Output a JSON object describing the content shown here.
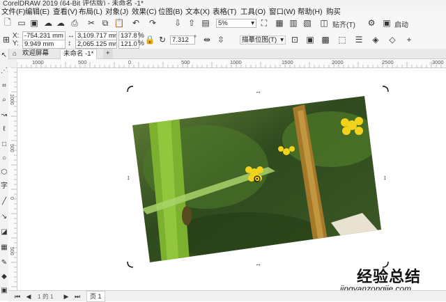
{
  "title": "CorelDRAW 2019 (64-Bit 评估版) - 未命名 -1*",
  "menu": [
    "文件(F)",
    "编辑(E)",
    "查看(V)",
    "布局(L)",
    "对象(J)",
    "效果(C)",
    "位图(B)",
    "文本(X)",
    "表格(T)",
    "工具(O)",
    "窗口(W)",
    "帮助(H)",
    "购买"
  ],
  "toolbar": {
    "zoom_value": "5%",
    "paste_label": "贴齐(T)",
    "launch_label": "启动"
  },
  "props": {
    "x_label": "X:",
    "x_value": "-754.231 mm",
    "y_label": "Y:",
    "y_value": "9.949 mm",
    "w_value": "3,109.717 mm",
    "h_value": "2,065.125 mm",
    "scale_w": "137.8",
    "scale_h": "121.0",
    "pct": "%",
    "angle_value": "7.312",
    "angle_unit": "°",
    "trace_label": "描摹位图(T)"
  },
  "tabs": {
    "welcome": "欢迎屏幕",
    "doc": "未命名 -1*",
    "add": "+"
  },
  "ruler": {
    "h_ticks": [
      "1000",
      "500",
      "0",
      "500",
      "1000",
      "1500",
      "2000",
      "2500",
      "3000"
    ],
    "v_ticks": [
      "1000",
      "500",
      "0",
      "500"
    ]
  },
  "status": {
    "page_label": "页 1",
    "nav": "1 的 1"
  },
  "watermark": {
    "cn": "经验总结",
    "url": "jingyanzongjie.com"
  },
  "colors": {
    "accent": "#1e6fd9",
    "photo_dark": "#2e4a1c",
    "photo_mid": "#4f7a2a",
    "photo_light": "#8fbf3a",
    "flower": "#f2d21a"
  }
}
